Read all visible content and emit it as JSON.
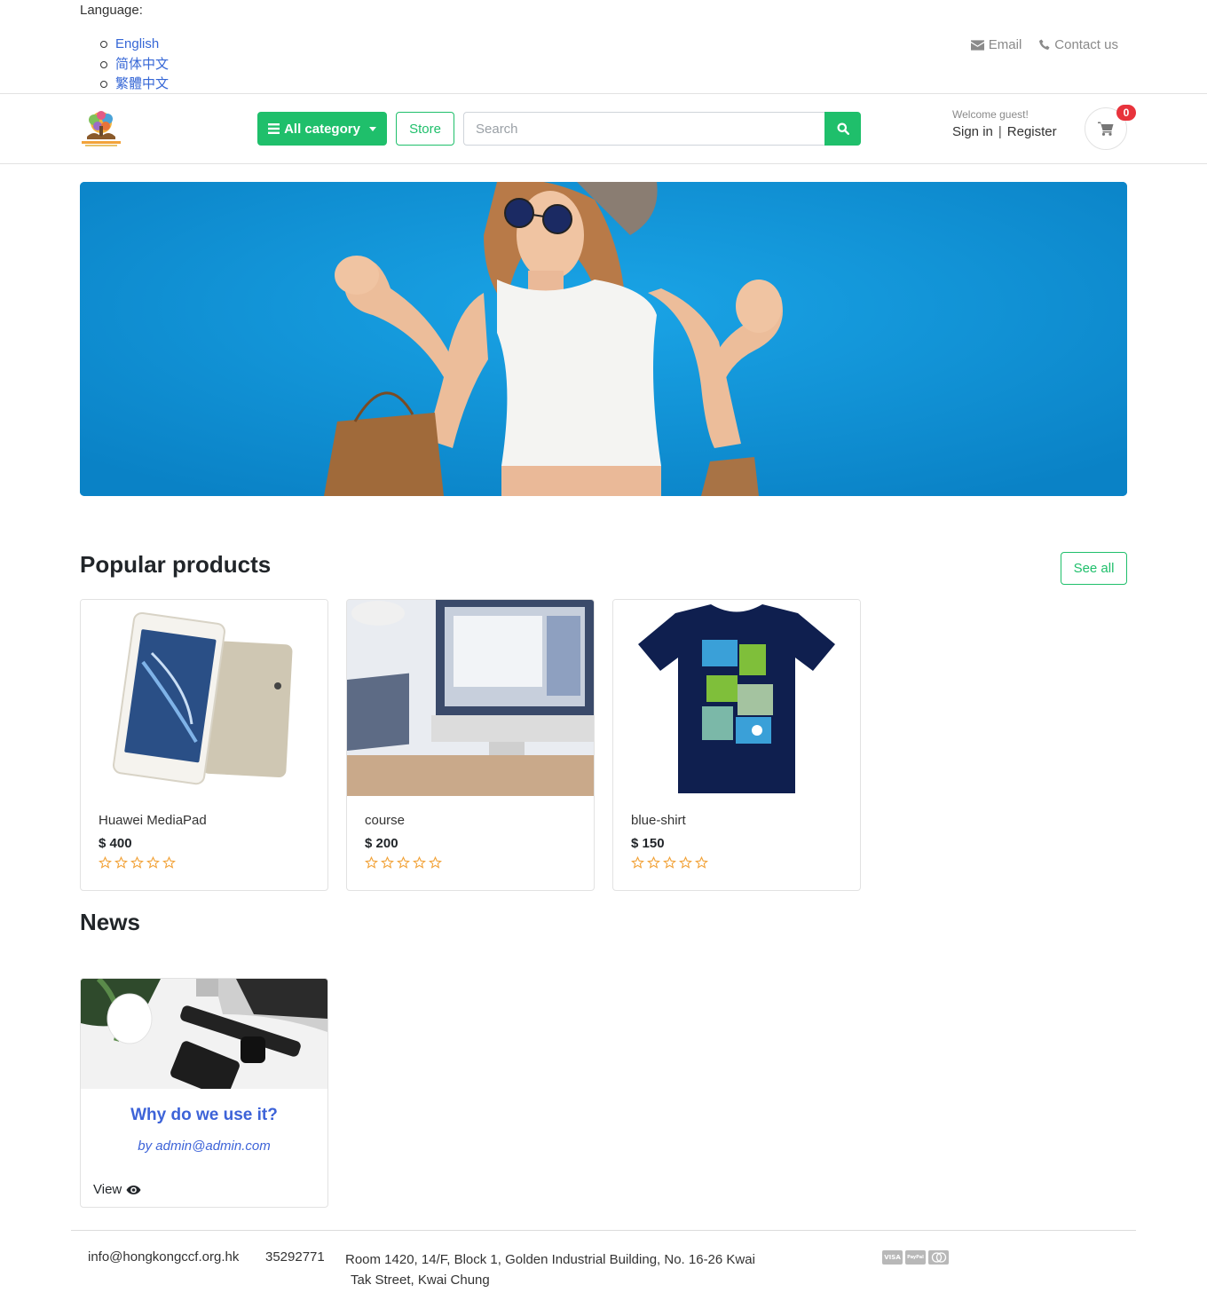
{
  "language": {
    "label": "Language:",
    "options": [
      "English",
      "简体中文",
      "繁體中文"
    ]
  },
  "top_contact": {
    "email_label": "Email",
    "contact_label": "Contact us"
  },
  "header": {
    "category_label": "All category",
    "store_label": "Store",
    "search_placeholder": "Search",
    "welcome_text": "Welcome guest!",
    "sign_in_label": "Sign in",
    "register_label": "Register",
    "cart_count": "0"
  },
  "popular": {
    "title": "Popular products",
    "see_all_label": "See all",
    "products": [
      {
        "name": "Huawei MediaPad",
        "price": "$ 400",
        "rating": 0
      },
      {
        "name": "course",
        "price": "$ 200",
        "rating": 0
      },
      {
        "name": "blue-shirt",
        "price": "$ 150",
        "rating": 0
      }
    ]
  },
  "news": {
    "title": "News",
    "items": [
      {
        "title": "Why do we use it?",
        "author": "by admin@admin.com",
        "view_label": "View"
      }
    ]
  },
  "footer": {
    "email": "info@hongkongccf.org.hk",
    "phone": "35292771",
    "address_line1": "Room 1420, 14/F, Block 1, Golden Industrial Building, No. 16-26 Kwai",
    "address_line2": "Tak Street, Kwai Chung",
    "payments": [
      "VISA",
      "PayPal",
      "mastercard"
    ]
  },
  "colors": {
    "accent": "#1fbf6b",
    "link": "#3667d6",
    "news_title": "#3d63d8",
    "badge": "#e8333c",
    "star": "#f2a33a"
  }
}
